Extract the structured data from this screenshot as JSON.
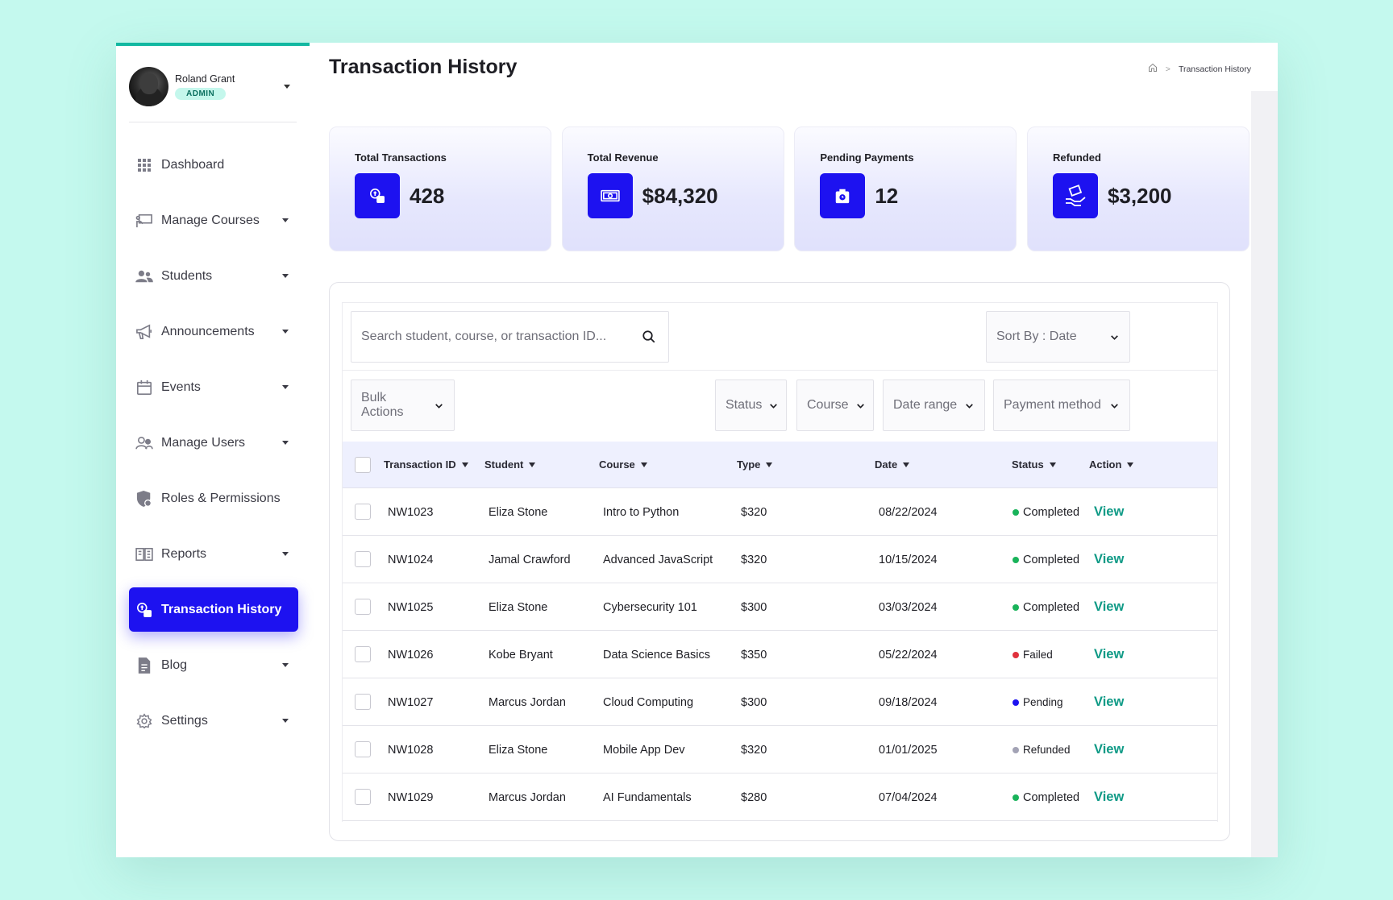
{
  "user": {
    "name": "Roland Grant",
    "role": "ADMIN"
  },
  "nav": [
    {
      "label": "Dashboard",
      "icon": "grid-icon",
      "caret": false,
      "active": false
    },
    {
      "label": "Manage Courses",
      "icon": "presentation-icon",
      "caret": true,
      "active": false
    },
    {
      "label": "Students",
      "icon": "users-icon",
      "caret": true,
      "active": false
    },
    {
      "label": "Announcements",
      "icon": "megaphone-icon",
      "caret": true,
      "active": false
    },
    {
      "label": "Events",
      "icon": "calendar-icon",
      "caret": true,
      "active": false
    },
    {
      "label": "Manage Users",
      "icon": "user-group-icon",
      "caret": true,
      "active": false
    },
    {
      "label": "Roles & Permissions",
      "icon": "shield-icon",
      "caret": false,
      "active": false
    },
    {
      "label": "Reports",
      "icon": "book-icon",
      "caret": true,
      "active": false
    },
    {
      "label": "Transaction History",
      "icon": "transaction-icon",
      "caret": false,
      "active": true
    },
    {
      "label": "Blog",
      "icon": "document-icon",
      "caret": true,
      "active": false
    },
    {
      "label": "Settings",
      "icon": "gear-icon",
      "caret": true,
      "active": false
    }
  ],
  "page": {
    "title": "Transaction History"
  },
  "breadcrumb": {
    "current": "Transaction History"
  },
  "stats": [
    {
      "label": "Total Transactions",
      "value": "428",
      "icon": "transaction-icon"
    },
    {
      "label": "Total Revenue",
      "value": "$84,320",
      "icon": "cash-icon"
    },
    {
      "label": "Pending Payments",
      "value": "12",
      "icon": "clock-bag-icon"
    },
    {
      "label": "Refunded",
      "value": "$3,200",
      "icon": "refund-hand-icon"
    }
  ],
  "search": {
    "placeholder": "Search student, course, or transaction ID..."
  },
  "sort": {
    "label": "Sort By : Date"
  },
  "filters": {
    "bulk": "Bulk Actions",
    "status": "Status",
    "course": "Course",
    "date": "Date range",
    "payment": "Payment method"
  },
  "table": {
    "columns": [
      "Transaction ID",
      "Student",
      "Course",
      "Type",
      "Date",
      "Status",
      "Action"
    ],
    "rows": [
      {
        "id": "NW1023",
        "student": "Eliza Stone",
        "course": "Intro to Python",
        "type": "$320",
        "date": "08/22/2024",
        "status": "Completed",
        "action": "View"
      },
      {
        "id": "NW1024",
        "student": "Jamal Crawford",
        "course": "Advanced JavaScript",
        "type": "$320",
        "date": "10/15/2024",
        "status": "Completed",
        "action": "View"
      },
      {
        "id": "NW1025",
        "student": "Eliza Stone",
        "course": "Cybersecurity 101",
        "type": "$300",
        "date": "03/03/2024",
        "status": "Completed",
        "action": "View"
      },
      {
        "id": "NW1026",
        "student": "Kobe Bryant",
        "course": "Data Science Basics",
        "type": "$350",
        "date": "05/22/2024",
        "status": "Failed",
        "action": "View"
      },
      {
        "id": "NW1027",
        "student": "Marcus Jordan",
        "course": "Cloud Computing",
        "type": "$300",
        "date": "09/18/2024",
        "status": "Pending",
        "action": "View"
      },
      {
        "id": "NW1028",
        "student": "Eliza Stone",
        "course": "Mobile App Dev",
        "type": "$320",
        "date": "01/01/2025",
        "status": "Refunded",
        "action": "View"
      },
      {
        "id": "NW1029",
        "student": "Marcus Jordan",
        "course": "AI Fundamentals",
        "type": "$280",
        "date": "07/04/2024",
        "status": "Completed",
        "action": "View"
      }
    ]
  },
  "status_colors": {
    "Completed": "#19b35a",
    "Failed": "#e0313d",
    "Pending": "#1d12f0",
    "Refunded": "#a3a3b5"
  },
  "colors": {
    "accent": "#1d12f0",
    "link": "#0f9a86",
    "background": "#c4f9ee"
  }
}
